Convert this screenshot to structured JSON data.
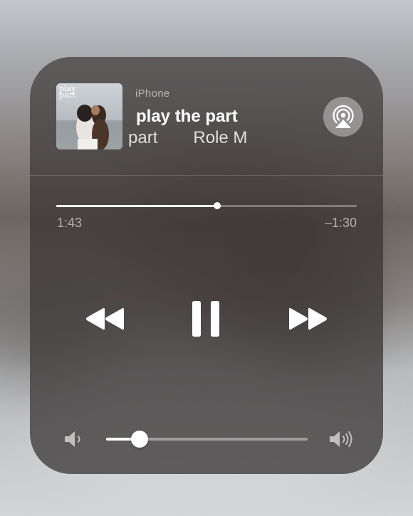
{
  "now_playing": {
    "artwork": {
      "text": "play\npart"
    },
    "device": "iPhone",
    "title": "play the part",
    "marquee": {
      "title_fragment": "ay the part",
      "artist_fragment": "Role M"
    }
  },
  "icons": {
    "airplay": "airplay-icon",
    "rewind": "rewind-icon",
    "pause": "pause-icon",
    "forward": "fast-forward-icon",
    "volume_min": "speaker-low-icon",
    "volume_max": "speaker-high-icon"
  },
  "progress": {
    "elapsed": "1:43",
    "remaining": "–1:30",
    "fraction": 0.535
  },
  "volume": {
    "fraction": 0.165
  },
  "colors": {
    "foreground": "#ffffff",
    "panel": "#46424299"
  }
}
